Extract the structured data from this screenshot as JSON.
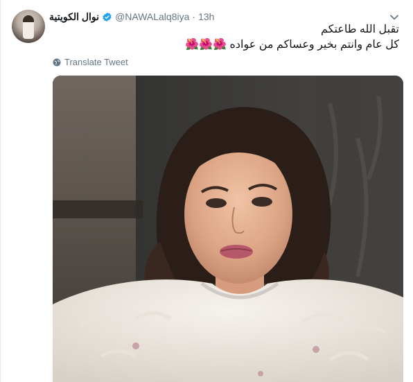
{
  "tweet": {
    "display_name": "نوال الكويتية",
    "handle": "@NAWALalq8iya",
    "separator": "·",
    "time": "13h",
    "text_line1": "تقبل الله طاعتكم",
    "text_line2": "كل عام وانتم بخير وعساكم من عواده 🌺🌺🌺",
    "translate_label": "Translate Tweet"
  },
  "icons": {
    "verified": "verified-badge-icon",
    "caret": "chevron-down-icon",
    "globe": "globe-icon"
  },
  "colors": {
    "accent": "#1da1f2",
    "secondary_text": "#657786",
    "primary_text": "#14171a"
  }
}
